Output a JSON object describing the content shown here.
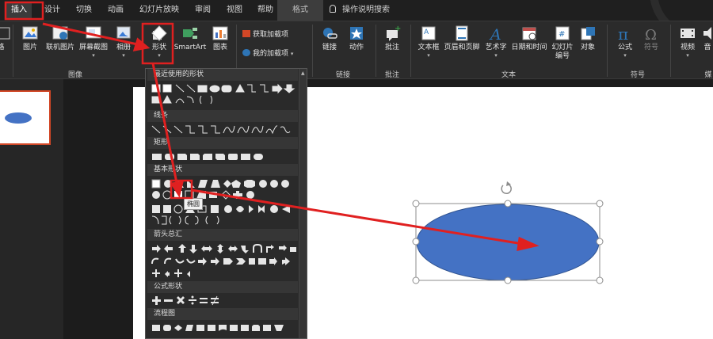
{
  "tabs": [
    {
      "key": "insert",
      "label": "插入",
      "active": true
    },
    {
      "key": "design",
      "label": "设计"
    },
    {
      "key": "transitions",
      "label": "切换"
    },
    {
      "key": "animations",
      "label": "动画"
    },
    {
      "key": "slideshow",
      "label": "幻灯片放映"
    },
    {
      "key": "review",
      "label": "审阅"
    },
    {
      "key": "view",
      "label": "视图"
    },
    {
      "key": "help",
      "label": "帮助"
    },
    {
      "key": "format",
      "label": "格式"
    }
  ],
  "tell_me": "操作说明搜索",
  "ribbon": {
    "images": {
      "picture": "图片",
      "online_picture": "联机图片",
      "screenshot": "屏幕截图",
      "album": "相册",
      "group": "图像"
    },
    "illustrations": {
      "shapes": "形状",
      "smartart": "SmartArt",
      "chart": "图表"
    },
    "addins": {
      "get": "获取加载项",
      "my": "我的加载项"
    },
    "links": {
      "link": "链接",
      "action": "动作",
      "group": "链接"
    },
    "comments": {
      "comment": "批注",
      "group": "批注"
    },
    "text": {
      "textbox": "文本框",
      "header_footer": "页眉和页脚",
      "wordart": "艺术字",
      "datetime": "日期和时间",
      "slide_number": "幻灯片\n编号",
      "object": "对象",
      "group": "文本"
    },
    "symbols": {
      "equation": "公式",
      "symbol": "符号",
      "group": "符号"
    },
    "media": {
      "video": "视频",
      "audio": "音",
      "group": "媒"
    }
  },
  "shapes_menu": {
    "sections": [
      "最近使用的形状",
      "线条",
      "矩形",
      "基本形状",
      "箭头总汇",
      "公式形状",
      "流程图"
    ],
    "tooltip": "椭圆"
  },
  "colors": {
    "accent_red": "#e02020",
    "shape_fill": "#4472c4",
    "tab_active": "#3b3b3b",
    "ribbon_bg": "#2b2b2b"
  }
}
